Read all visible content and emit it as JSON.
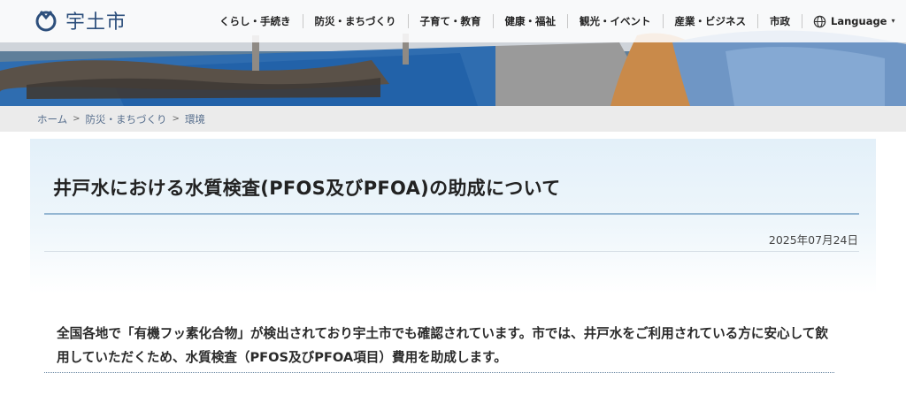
{
  "site": {
    "logo_text": "宇土市",
    "logo_icon": "city-emblem-icon"
  },
  "nav": {
    "items": [
      "くらし・手続き",
      "防災・まちづくり",
      "子育て・教育",
      "健康・福祉",
      "観光・イベント",
      "産業・ビジネス",
      "市政"
    ],
    "language_label": "Language",
    "language_icon": "globe-icon",
    "language_caret": "▾"
  },
  "breadcrumb": {
    "items": [
      "ホーム",
      "防災・まちづくり",
      "環境"
    ],
    "separator": ">"
  },
  "article": {
    "title": "井戸水における水質検査(PFOS及びPFOA)の助成について",
    "date": "2025年07月24日",
    "lead": "全国各地で「有機フッ素化合物」が検出されており宇土市でも確認されています。市では、井戸水をご利用されている方に安心して飲用していただくため、水質検査（PFOS及びPFOA項目）費用を助成します。"
  },
  "colors": {
    "brand": "#2d4f7c",
    "breadcrumb_bg": "#ebebeb",
    "title_rule": "#93b6d2",
    "link": "#556d8c"
  }
}
